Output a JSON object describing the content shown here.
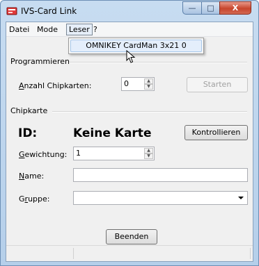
{
  "window": {
    "title": "IVS-Card Link"
  },
  "menu": {
    "datei": "Datei",
    "mode": "Mode",
    "leser": "Leser",
    "help": "?"
  },
  "popup": {
    "item": "OMNIKEY CardMan 3x21 0"
  },
  "programmieren": {
    "title": "Programmieren",
    "anzahl_prefix": "A",
    "anzahl_rest": "nzahl Chipkarten:",
    "anzahl_value": "0",
    "start_button": "Starten"
  },
  "chipkarte": {
    "title": "Chipkarte",
    "id_label": "ID:",
    "id_value": "Keine Karte",
    "check_button": "Kontrollieren",
    "gewichtung_prefix": "G",
    "gewichtung_rest": "ewichtung:",
    "gewichtung_value": "1",
    "name_prefix": "N",
    "name_rest": "ame:",
    "name_value": "",
    "gruppe_prefix": "G",
    "gruppe_u": "r",
    "gruppe_rest": "uppe:",
    "gruppe_value": ""
  },
  "footer": {
    "exit_button": "Beenden"
  },
  "title_buttons": {
    "minimize": "—",
    "maximize": "□",
    "close": "X"
  }
}
